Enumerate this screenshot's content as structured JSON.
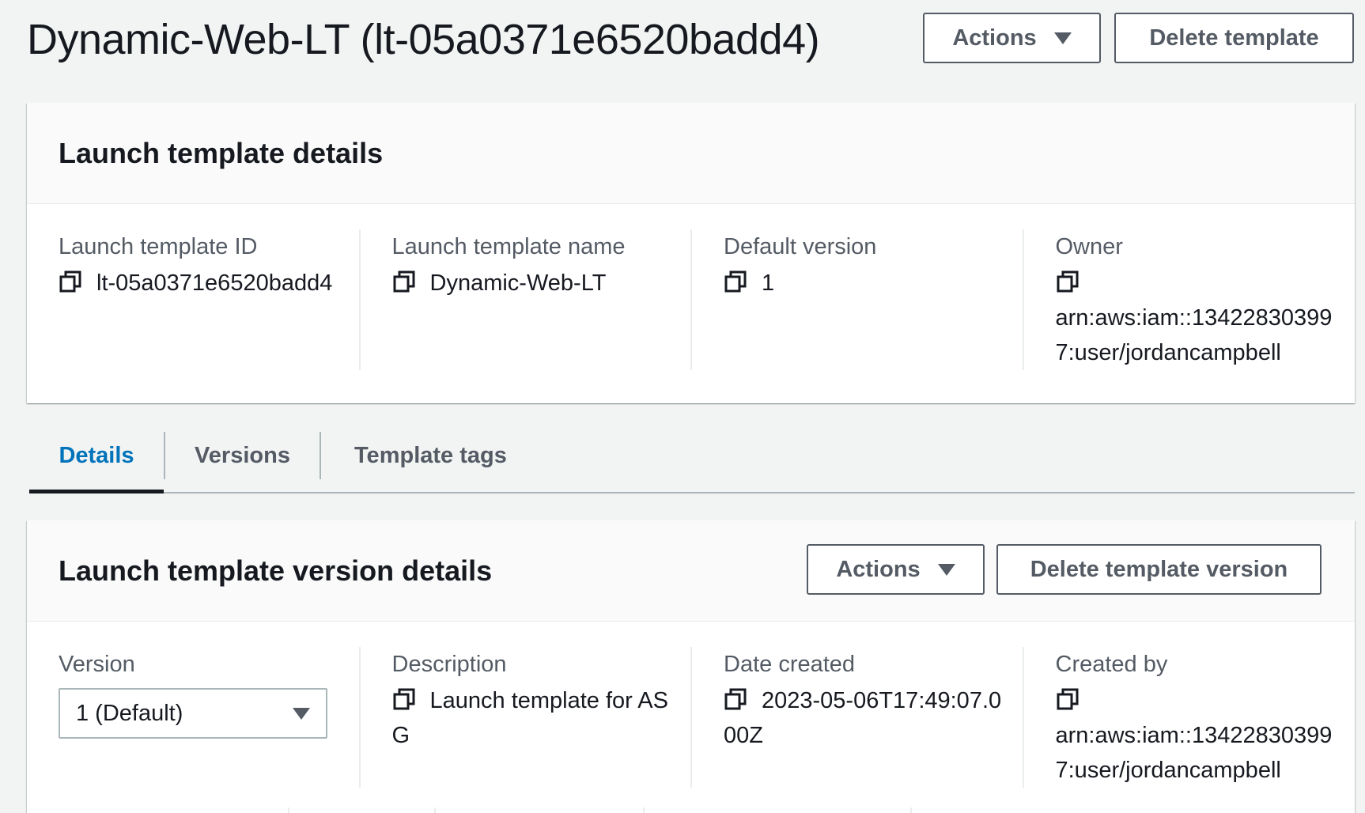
{
  "header": {
    "title": "Dynamic-Web-LT (lt-05a0371e6520badd4)",
    "actions_label": "Actions",
    "delete_label": "Delete template"
  },
  "details_panel": {
    "title": "Launch template details",
    "fields": [
      {
        "label": "Launch template ID",
        "value": "lt-05a0371e6520badd4"
      },
      {
        "label": "Launch template name",
        "value": "Dynamic-Web-LT"
      },
      {
        "label": "Default version",
        "value": "1"
      },
      {
        "label": "Owner",
        "value": "arn:aws:iam::134228303997:user/jordancampbell"
      }
    ]
  },
  "tabs": [
    {
      "label": "Details",
      "active": true
    },
    {
      "label": "Versions",
      "active": false
    },
    {
      "label": "Template tags",
      "active": false
    }
  ],
  "version_panel": {
    "title": "Launch template version details",
    "actions_label": "Actions",
    "delete_label": "Delete template version",
    "version": {
      "label": "Version",
      "selected": "1 (Default)"
    },
    "fields": [
      {
        "label": "Description",
        "value": "Launch template for ASG"
      },
      {
        "label": "Date created",
        "value": "2023-05-06T17:49:07.000Z"
      },
      {
        "label": "Created by",
        "value": "arn:aws:iam::134228303997:user/jordancampbell"
      }
    ]
  },
  "colors": {
    "accent": "#0073bb",
    "text": "#16191f",
    "muted": "#545b64",
    "border": "#eaeded",
    "page_bg": "#f2f3f3"
  }
}
